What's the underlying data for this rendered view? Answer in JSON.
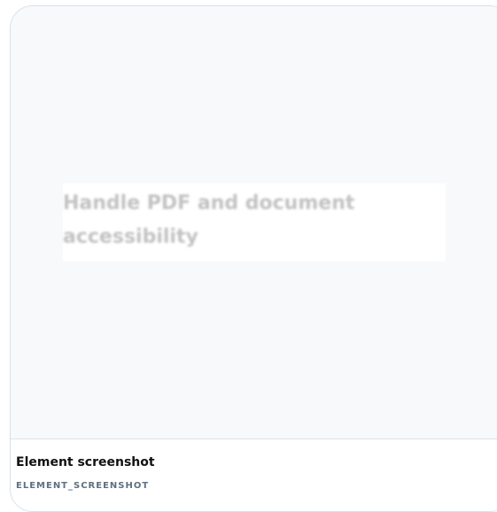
{
  "card": {
    "preview_text": "Handle PDF and document accessibility",
    "title": "Element screenshot",
    "type_label": "ELEMENT_SCREENSHOT"
  },
  "colors": {
    "card_border": "#d5e1ec",
    "preview_background": "#f8f9fb",
    "preview_text": "#c2c2c2",
    "title_text": "#111111",
    "type_label_text": "#5f6f7f"
  }
}
